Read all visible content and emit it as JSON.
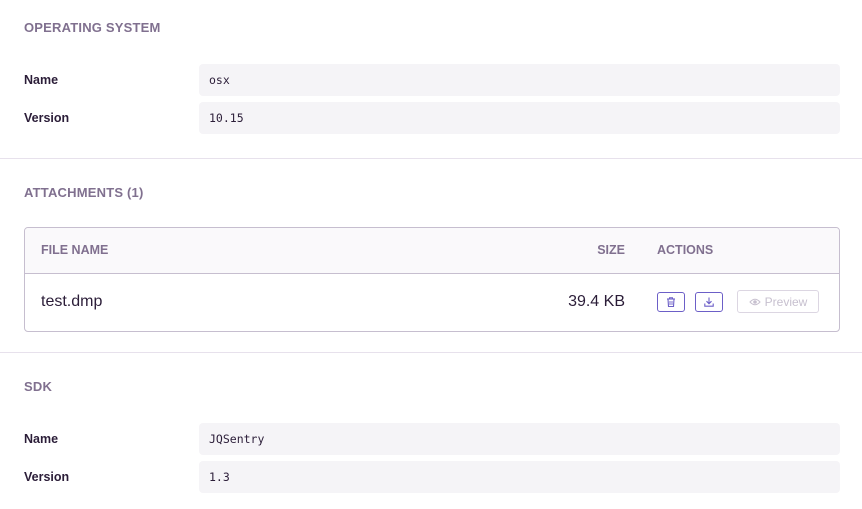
{
  "os_section": {
    "title": "OPERATING SYSTEM",
    "rows": [
      {
        "key": "Name",
        "value": "osx"
      },
      {
        "key": "Version",
        "value": "10.15"
      }
    ]
  },
  "attachments_section": {
    "title": "ATTACHMENTS (1)",
    "columns": {
      "file_name": "FILE NAME",
      "size": "SIZE",
      "actions": "ACTIONS"
    },
    "rows": [
      {
        "file_name": "test.dmp",
        "size": "39.4 KB",
        "preview_label": "Preview"
      }
    ],
    "icons": {
      "delete": "trash-icon",
      "download": "download-icon",
      "preview": "eye-icon"
    }
  },
  "sdk_section": {
    "title": "SDK",
    "rows": [
      {
        "key": "Name",
        "value": "JQSentry"
      },
      {
        "key": "Version",
        "value": "1.3"
      }
    ]
  },
  "colors": {
    "accent": "#6c5fc7",
    "heading": "#80708f",
    "text": "#2b1d38",
    "value_bg": "#f5f4f7",
    "border": "#c6becf"
  }
}
